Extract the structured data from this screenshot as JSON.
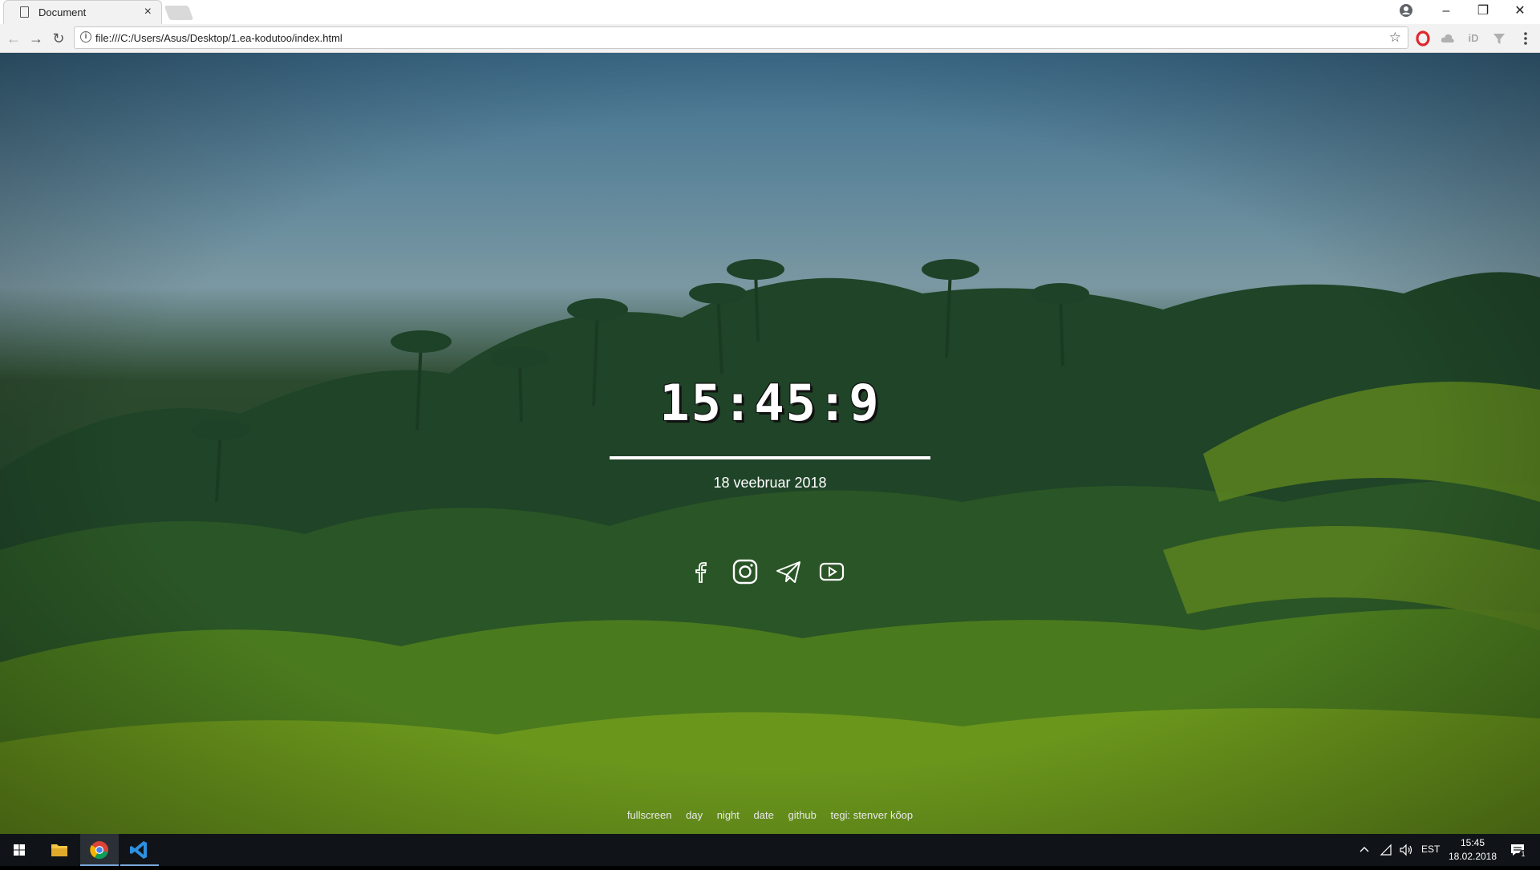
{
  "browser": {
    "tab_title": "Document",
    "tab_close": "×",
    "url": "file:///C:/Users/Asus/Desktop/1.ea-kodutoo/index.html",
    "window_controls": {
      "minimize": "–",
      "restore": "❐",
      "close": "✕"
    },
    "extensions": [
      "opera-icon",
      "cloud-icon",
      "id-icon",
      "filter-icon",
      "menu-icon"
    ],
    "extension_id_label": "iD"
  },
  "page": {
    "clock": "15:45:9",
    "date": "18 veebruar 2018",
    "social": [
      "facebook-icon",
      "instagram-icon",
      "telegram-icon",
      "youtube-icon"
    ],
    "footer_links": [
      "fullscreen",
      "day",
      "night",
      "date",
      "github",
      "tegi: stenver kõop"
    ]
  },
  "taskbar": {
    "apps": [
      "start-icon",
      "file-explorer-icon",
      "chrome-icon",
      "vscode-icon"
    ],
    "language": "EST",
    "time": "15:45",
    "date": "18.02.2018",
    "notification_count": "1"
  },
  "colors": {
    "accent": "#ffffff",
    "taskbar": "#101418",
    "chrome_bg": "#f2f2f2"
  }
}
